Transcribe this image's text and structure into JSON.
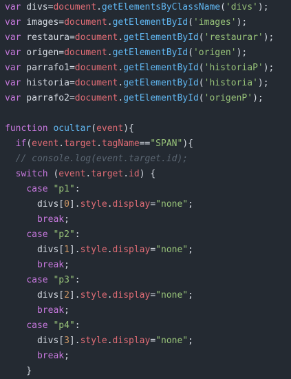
{
  "editor": {
    "lines": [
      [
        [
          "kw",
          "var"
        ],
        [
          "pl",
          " divs"
        ],
        [
          "pl",
          "="
        ],
        [
          "pr",
          "document"
        ],
        [
          "pl",
          "."
        ],
        [
          "fn",
          "getElementsByClassName"
        ],
        [
          "pl",
          "("
        ],
        [
          "str",
          "'divs'"
        ],
        [
          "pl",
          ");"
        ]
      ],
      [
        [
          "kw",
          "var"
        ],
        [
          "pl",
          " images"
        ],
        [
          "pl",
          "="
        ],
        [
          "pr",
          "document"
        ],
        [
          "pl",
          "."
        ],
        [
          "fn",
          "getElementById"
        ],
        [
          "pl",
          "("
        ],
        [
          "str",
          "'images'"
        ],
        [
          "pl",
          ");"
        ]
      ],
      [
        [
          "kw",
          "var"
        ],
        [
          "pl",
          " restaura"
        ],
        [
          "pl",
          "="
        ],
        [
          "pr",
          "document"
        ],
        [
          "pl",
          "."
        ],
        [
          "fn",
          "getElementById"
        ],
        [
          "pl",
          "("
        ],
        [
          "str",
          "'restaurar'"
        ],
        [
          "pl",
          ");"
        ]
      ],
      [
        [
          "kw",
          "var"
        ],
        [
          "pl",
          " origen"
        ],
        [
          "pl",
          "="
        ],
        [
          "pr",
          "document"
        ],
        [
          "pl",
          "."
        ],
        [
          "fn",
          "getElementById"
        ],
        [
          "pl",
          "("
        ],
        [
          "str",
          "'origen'"
        ],
        [
          "pl",
          ");"
        ]
      ],
      [
        [
          "kw",
          "var"
        ],
        [
          "pl",
          " parrafo1"
        ],
        [
          "pl",
          "="
        ],
        [
          "pr",
          "document"
        ],
        [
          "pl",
          "."
        ],
        [
          "fn",
          "getElementById"
        ],
        [
          "pl",
          "("
        ],
        [
          "str",
          "'historiaP'"
        ],
        [
          "pl",
          ");"
        ]
      ],
      [
        [
          "kw",
          "var"
        ],
        [
          "pl",
          " historia"
        ],
        [
          "pl",
          "="
        ],
        [
          "pr",
          "document"
        ],
        [
          "pl",
          "."
        ],
        [
          "fn",
          "getElementById"
        ],
        [
          "pl",
          "("
        ],
        [
          "str",
          "'historia'"
        ],
        [
          "pl",
          ");"
        ]
      ],
      [
        [
          "kw",
          "var"
        ],
        [
          "pl",
          " parrafo2"
        ],
        [
          "pl",
          "="
        ],
        [
          "pr",
          "document"
        ],
        [
          "pl",
          "."
        ],
        [
          "fn",
          "getElementById"
        ],
        [
          "pl",
          "("
        ],
        [
          "str",
          "'origenP'"
        ],
        [
          "pl",
          ");"
        ]
      ],
      [],
      [
        [
          "kw",
          "function"
        ],
        [
          "pl",
          " "
        ],
        [
          "fn",
          "ocultar"
        ],
        [
          "pl",
          "("
        ],
        [
          "pr",
          "event"
        ],
        [
          "pl",
          "){"
        ]
      ],
      [
        [
          "pl",
          "  "
        ],
        [
          "kw",
          "if"
        ],
        [
          "pl",
          "("
        ],
        [
          "pr",
          "event"
        ],
        [
          "pl",
          "."
        ],
        [
          "pr",
          "target"
        ],
        [
          "pl",
          "."
        ],
        [
          "pr",
          "tagName"
        ],
        [
          "pl",
          "=="
        ],
        [
          "str",
          "\"SPAN\""
        ],
        [
          "pl",
          "){"
        ]
      ],
      [
        [
          "pl",
          "  "
        ],
        [
          "cm",
          "// console.log(event.target.id);"
        ]
      ],
      [
        [
          "pl",
          "  "
        ],
        [
          "kw",
          "switch"
        ],
        [
          "pl",
          " ("
        ],
        [
          "pr",
          "event"
        ],
        [
          "pl",
          "."
        ],
        [
          "pr",
          "target"
        ],
        [
          "pl",
          "."
        ],
        [
          "pr",
          "id"
        ],
        [
          "pl",
          ") {"
        ]
      ],
      [
        [
          "pl",
          "    "
        ],
        [
          "kw",
          "case"
        ],
        [
          "pl",
          " "
        ],
        [
          "str",
          "\"p1\""
        ],
        [
          "pl",
          ":"
        ]
      ],
      [
        [
          "pl",
          "      divs["
        ],
        [
          "nm",
          "0"
        ],
        [
          "pl",
          "]."
        ],
        [
          "pr",
          "style"
        ],
        [
          "pl",
          "."
        ],
        [
          "pr",
          "display"
        ],
        [
          "pl",
          "="
        ],
        [
          "str",
          "\"none\""
        ],
        [
          "pl",
          ";"
        ]
      ],
      [
        [
          "pl",
          "      "
        ],
        [
          "kw",
          "break"
        ],
        [
          "pl",
          ";"
        ]
      ],
      [
        [
          "pl",
          "    "
        ],
        [
          "kw",
          "case"
        ],
        [
          "pl",
          " "
        ],
        [
          "str",
          "\"p2\""
        ],
        [
          "pl",
          ":"
        ]
      ],
      [
        [
          "pl",
          "      divs["
        ],
        [
          "nm",
          "1"
        ],
        [
          "pl",
          "]."
        ],
        [
          "pr",
          "style"
        ],
        [
          "pl",
          "."
        ],
        [
          "pr",
          "display"
        ],
        [
          "pl",
          "="
        ],
        [
          "str",
          "\"none\""
        ],
        [
          "pl",
          ";"
        ]
      ],
      [
        [
          "pl",
          "      "
        ],
        [
          "kw",
          "break"
        ],
        [
          "pl",
          ";"
        ]
      ],
      [
        [
          "pl",
          "    "
        ],
        [
          "kw",
          "case"
        ],
        [
          "pl",
          " "
        ],
        [
          "str",
          "\"p3\""
        ],
        [
          "pl",
          ":"
        ]
      ],
      [
        [
          "pl",
          "      divs["
        ],
        [
          "nm",
          "2"
        ],
        [
          "pl",
          "]."
        ],
        [
          "pr",
          "style"
        ],
        [
          "pl",
          "."
        ],
        [
          "pr",
          "display"
        ],
        [
          "pl",
          "="
        ],
        [
          "str",
          "\"none\""
        ],
        [
          "pl",
          ";"
        ]
      ],
      [
        [
          "pl",
          "      "
        ],
        [
          "kw",
          "break"
        ],
        [
          "pl",
          ";"
        ]
      ],
      [
        [
          "pl",
          "    "
        ],
        [
          "kw",
          "case"
        ],
        [
          "pl",
          " "
        ],
        [
          "str",
          "\"p4\""
        ],
        [
          "pl",
          ":"
        ]
      ],
      [
        [
          "pl",
          "      divs["
        ],
        [
          "nm",
          "3"
        ],
        [
          "pl",
          "]."
        ],
        [
          "pr",
          "style"
        ],
        [
          "pl",
          "."
        ],
        [
          "pr",
          "display"
        ],
        [
          "pl",
          "="
        ],
        [
          "str",
          "\"none\""
        ],
        [
          "pl",
          ";"
        ]
      ],
      [
        [
          "pl",
          "      "
        ],
        [
          "kw",
          "break"
        ],
        [
          "pl",
          ";"
        ]
      ],
      [
        [
          "pl",
          "    }"
        ]
      ]
    ]
  },
  "colors": {
    "background": "#242a32",
    "keyword": "#c678dd",
    "function": "#60b6f0",
    "string": "#98c379",
    "comment": "#5c6773",
    "plain": "#d6dbe3",
    "number": "#d19a66",
    "property": "#e06c75"
  }
}
